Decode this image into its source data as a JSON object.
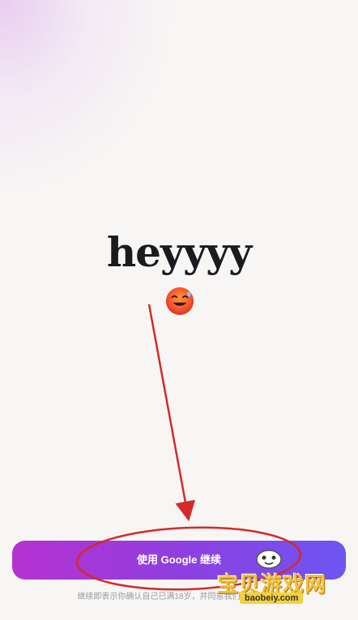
{
  "headline": "heyyyy",
  "emoji_icon": "hot-face-emoji",
  "continue_button": {
    "label": "使用 Google 继续"
  },
  "terms_text": "继续即表示你确认自己已满18岁，并同意我们的服务条款",
  "watermark": {
    "cn": "宝贝游戏网",
    "url": "baobeiy.com"
  },
  "colors": {
    "button_start": "#b632d0",
    "button_end": "#6d55f2",
    "annotation_red": "#d42a2a",
    "headline": "#1a1a1f"
  }
}
